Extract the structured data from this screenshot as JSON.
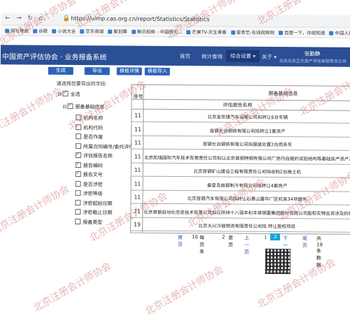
{
  "browser": {
    "url": "https://uimp.cas.org.cn/report/Statistics/Statistics",
    "bookmarks": [
      "网址导航",
      "谷歌",
      "小说大全",
      "京东商城",
      "聚划算",
      "腾讯视频 - 中国领先...",
      "芒果TV-天生青春",
      "爱奇艺-在线视频网",
      "百度一下，你就知道",
      "中国人民银行-首页",
      "优酷 - 为好内容全力"
    ]
  },
  "app": {
    "title": "中国资产评估协会 · 业务报备系统",
    "nav": [
      "首页",
      "统计查询",
      "综合设置 ▾",
      "关于 ▾"
    ],
    "nav_active_index": 2,
    "user_name": "张勤静",
    "user_org": "北京北京正元资产评估有限责任公司"
  },
  "toolbar": {
    "buttons": [
      "生成",
      "导出",
      "模板详情",
      "模板导入"
    ]
  },
  "fields": {
    "hint": "请选择您要导出的字段:",
    "select_all": "全选",
    "group": "报备基础信息",
    "items": [
      {
        "label": "机构名称",
        "checked": false
      },
      {
        "label": "机构代码",
        "checked": false
      },
      {
        "label": "是否作废",
        "checked": false
      },
      {
        "label": "所属合同编号/委托评估函编号",
        "checked": false
      },
      {
        "label": "评估报告名称",
        "checked": true
      },
      {
        "label": "报告编码",
        "checked": true
      },
      {
        "label": "报告文号",
        "checked": true
      },
      {
        "label": "是否涉密",
        "checked": false
      },
      {
        "label": "涉密等级",
        "checked": false
      },
      {
        "label": "涉密起始日期",
        "checked": false
      },
      {
        "label": "涉密截止日期",
        "checked": false
      },
      {
        "label": "报备类型",
        "checked": false
      }
    ]
  },
  "table": {
    "seq_header": "序号",
    "group_header": "报备基础信息",
    "col_header": "评估报告名称",
    "rows": [
      {
        "seq": "11",
        "name": "北京金安捷汽车运输公司拟转让6台车辆"
      },
      {
        "seq": "11",
        "name": "首钢长治钢铁有限公司拟转让1套资产"
      },
      {
        "seq": "11",
        "name": "首钢长治钢铁有限公司拟报废处置2台商务车"
      },
      {
        "seq": "11",
        "name": "北京凯瑞国际汽车技术有限责任公司拟以北京首钢特钢有限公司厂房内自建的试验结构等基础房产资产及财务项目"
      },
      {
        "seq": "11",
        "name": "北京首钢矿山建设工程有限责任公司拟收购2台推土机"
      },
      {
        "seq": "11",
        "name": "秦皇岛首钢制冷有限公司拟转让4套房产"
      },
      {
        "seq": "11",
        "name": "北京首钢汽车有限公司拟转让石景山露华厂区机泵34项器件"
      },
      {
        "seq": "11",
        "name": "北京首钢自动化信息技术有限公司拟以所持十八强辛利丰首钢重集团股份有限公司股权实物出资涉及的相关专利"
      },
      {
        "seq": "19",
        "name": "北京大兴冷链物流有限责任公司拟 转让股权项目"
      }
    ]
  },
  "pager": {
    "first": "首页",
    "page_size": "10",
    "page_size_label": "每页 条",
    "page_input": "2",
    "page_label": "第页",
    "prev": "上一页",
    "pages": [
      "1",
      "2"
    ],
    "current": "2",
    "next": "下一页",
    "last": "尾页",
    "total": "共19条数据"
  },
  "watermark": {
    "text": "北京注册会计师协会"
  }
}
